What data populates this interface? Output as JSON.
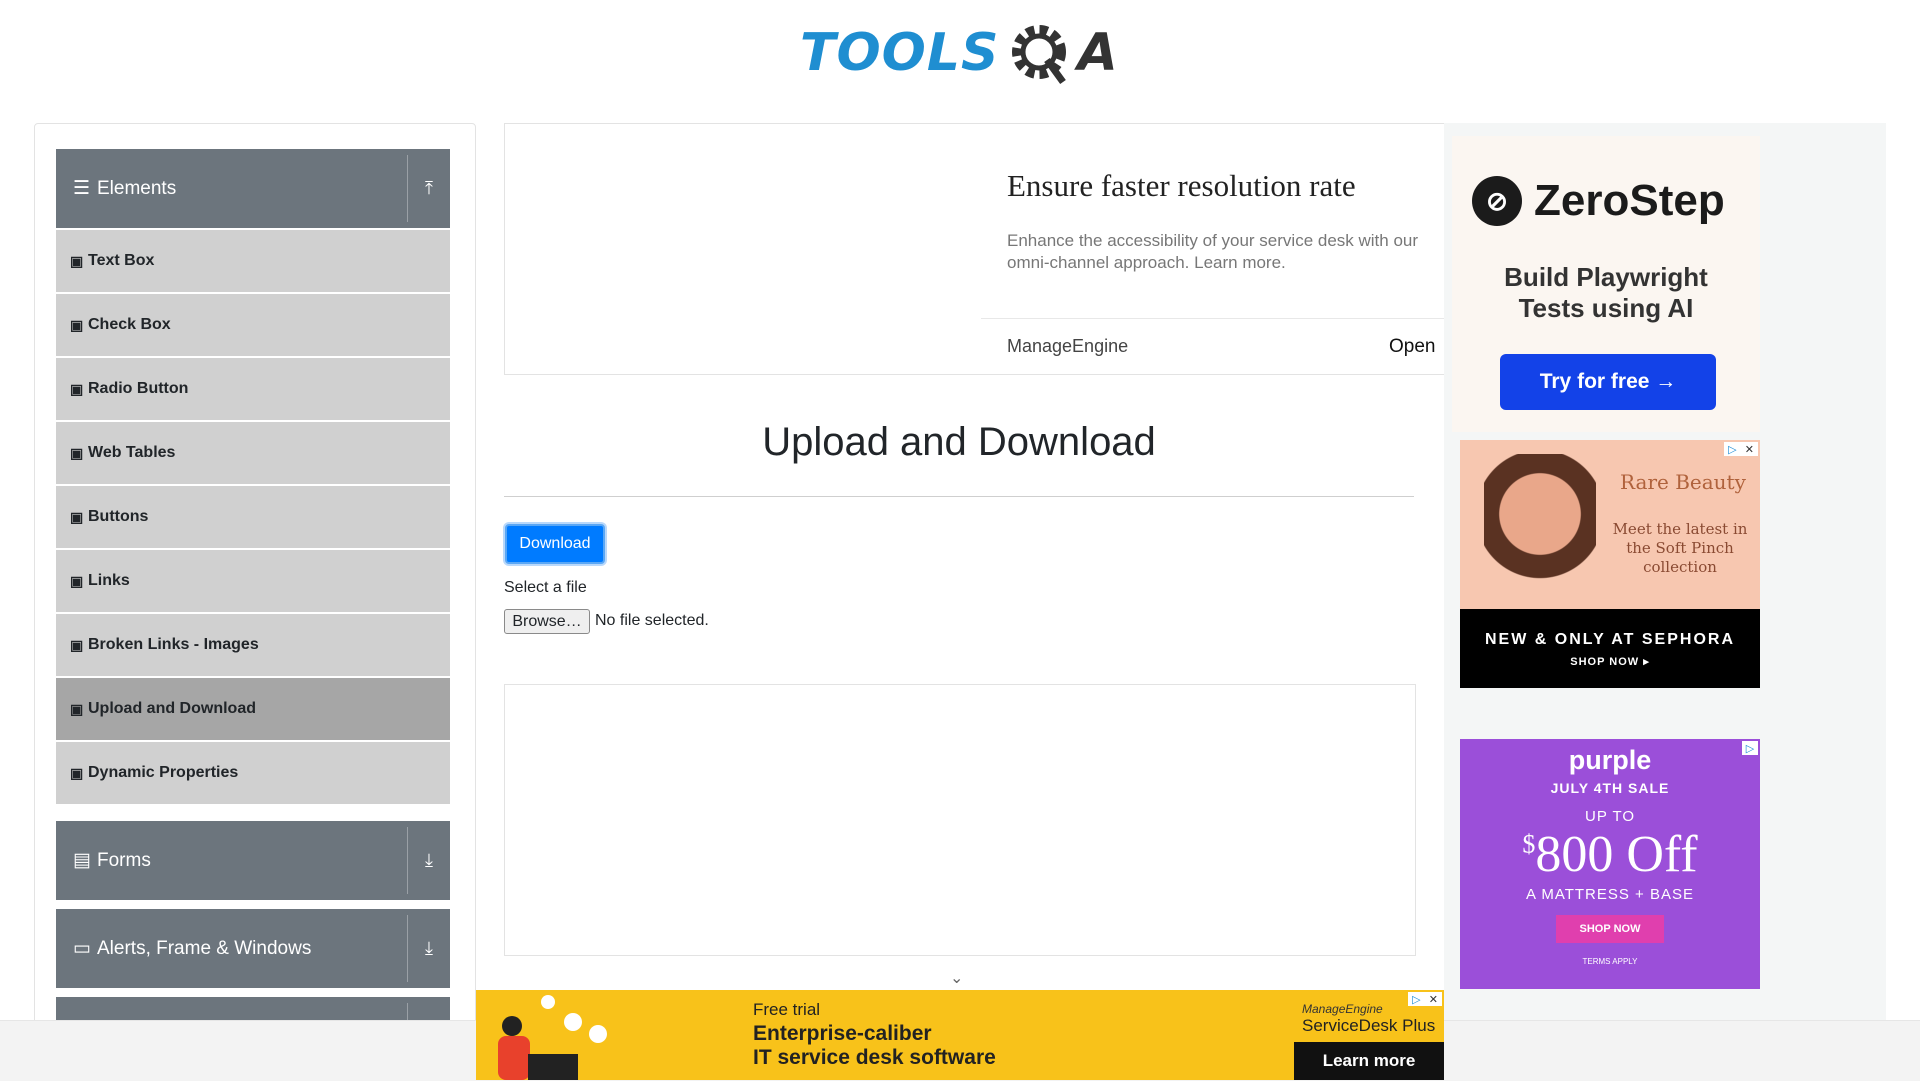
{
  "header": {
    "logo_text_left": "TOOLS",
    "logo_text_right": "A"
  },
  "sidebar": {
    "groups": [
      {
        "title": "Elements",
        "icon": "hamburger-icon",
        "arrow": "collapse-up-icon"
      },
      {
        "title": "Forms",
        "icon": "form-icon",
        "arrow": "expand-down-icon"
      },
      {
        "title": "Alerts, Frame & Windows",
        "icon": "window-icon",
        "arrow": "expand-down-icon"
      }
    ],
    "items": [
      {
        "label": "Text Box"
      },
      {
        "label": "Check Box"
      },
      {
        "label": "Radio Button"
      },
      {
        "label": "Web Tables"
      },
      {
        "label": "Buttons"
      },
      {
        "label": "Links"
      },
      {
        "label": "Broken Links - Images"
      },
      {
        "label": "Upload and Download",
        "active": true
      },
      {
        "label": "Dynamic Properties"
      }
    ]
  },
  "top_ad": {
    "headline": "Ensure faster resolution rate",
    "body": "Enhance the accessibility of your service desk with our omni-channel approach. Learn more.",
    "brand": "ManageEngine",
    "cta": "Open"
  },
  "main": {
    "title": "Upload and Download",
    "download_label": "Download",
    "select_label": "Select a file",
    "browse_label": "Browse…",
    "file_status": "No file selected."
  },
  "ads": {
    "zerostep": {
      "brand": "ZeroStep",
      "tagline_1": "Build Playwright",
      "tagline_2": "Tests using AI",
      "cta": "Try for free →"
    },
    "rare_beauty": {
      "brand": "Rare Beauty",
      "copy": "Meet the latest in the Soft Pinch collection",
      "band_1": "NEW & ONLY AT SEPHORA",
      "band_2": "SHOP NOW ▸"
    },
    "purple": {
      "logo": "purple",
      "sale": "JULY 4TH SALE",
      "upto": "UP TO",
      "currency": "$",
      "offer": "800 Off",
      "product": "A MATTRESS + BASE",
      "cta": "SHOP NOW",
      "terms": "TERMS APPLY"
    },
    "bottom": {
      "free": "Free trial",
      "line1": "Enterprise-caliber",
      "line2": "IT service desk software",
      "vendor": "ManageEngine",
      "product": "ServiceDesk Plus",
      "cta": "Learn more"
    }
  },
  "colors": {
    "sidebar_header": "#6c757d",
    "sidebar_item": "#d0d0d0",
    "primary": "#007bff",
    "logo_blue": "#1f8ed1"
  }
}
